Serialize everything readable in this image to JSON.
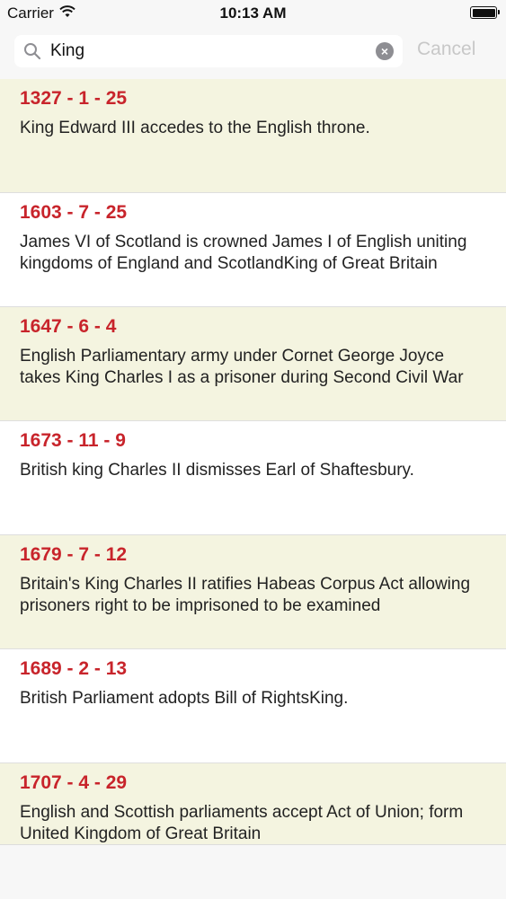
{
  "status_bar": {
    "carrier": "Carrier",
    "time": "10:13 AM"
  },
  "search": {
    "value": "King",
    "cancel_label": "Cancel"
  },
  "events": [
    {
      "date": "1327 - 1 - 25",
      "text": "King Edward III accedes to the English throne."
    },
    {
      "date": "1603 - 7 - 25",
      "text": "James VI of Scotland is crowned James I of English uniting kingdoms of England and ScotlandKing of Great Britain"
    },
    {
      "date": "1647 - 6 - 4",
      "text": "English Parliamentary army under Cornet George Joyce takes King Charles I as a prisoner during Second Civil War"
    },
    {
      "date": "1673 - 11 - 9",
      "text": "British king Charles II dismisses Earl of Shaftesbury."
    },
    {
      "date": "1679 - 7 - 12",
      "text": "Britain's King Charles II ratifies Habeas Corpus Act allowing prisoners right to be imprisoned to be examined"
    },
    {
      "date": "1689 - 2 - 13",
      "text": "British Parliament adopts Bill of RightsKing."
    },
    {
      "date": "1707 - 4 - 29",
      "text": "English and Scottish parliaments accept Act of Union; form United Kingdom of Great Britain"
    }
  ],
  "colors": {
    "date": "#c8242b",
    "alt_row": "#f4f4e0",
    "cancel_disabled": "#c8c8c8"
  },
  "icons": [
    "wifi-icon",
    "battery-icon",
    "search-icon",
    "clear-icon"
  ]
}
